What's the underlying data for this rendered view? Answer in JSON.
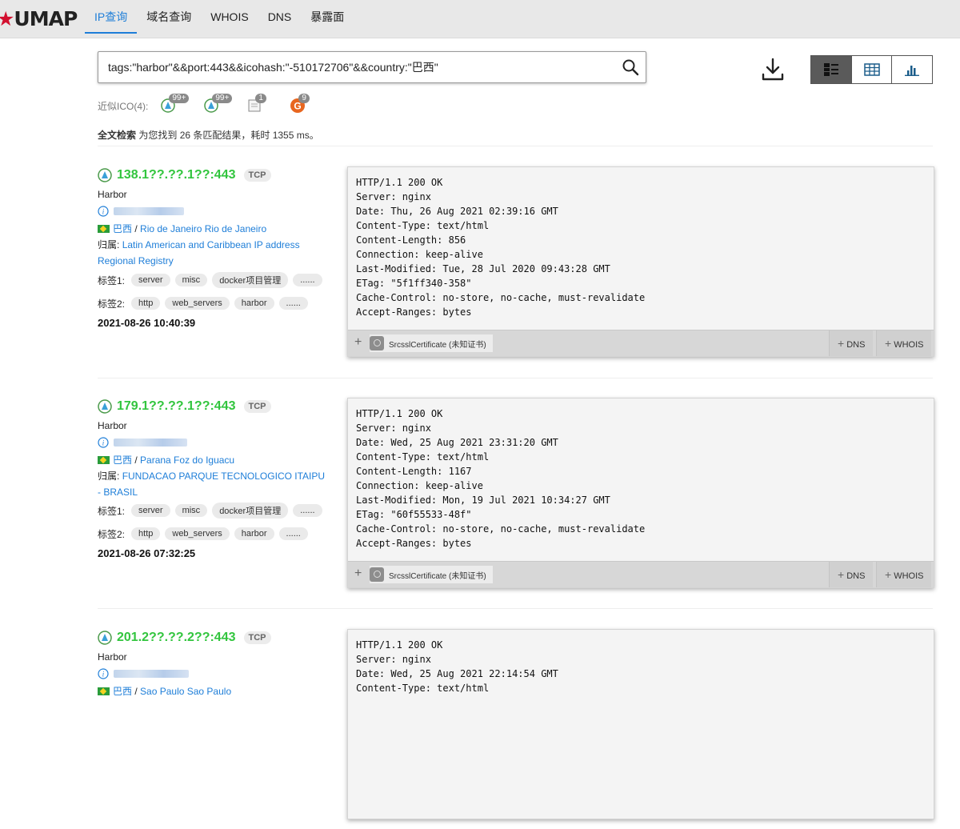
{
  "nav": {
    "logo_mark": "★",
    "logo_text": "UMAP",
    "items": [
      "IP查询",
      "域名查询",
      "WHOIS",
      "DNS",
      "暴露面"
    ]
  },
  "search": {
    "query": "tags:\"harbor\"&&port:443&&icohash:\"-510172706\"&&country:\"巴西\""
  },
  "similar": {
    "label": "近似ICO(4):",
    "items": [
      {
        "icon": "harbor-icon",
        "count": "99+"
      },
      {
        "icon": "harbor-icon",
        "count": "99+"
      },
      {
        "icon": "document-icon",
        "count": "1"
      },
      {
        "icon": "g-logo-icon",
        "count": "9"
      }
    ]
  },
  "summary": {
    "prefix": "全文检索",
    "text": "为您找到 26 条匹配结果，耗时 1355 ms。"
  },
  "results": [
    {
      "ip": "138.1??.??.1??:443",
      "protocol": "TCP",
      "app": "Harbor",
      "country": "巴西",
      "location": "Rio de Janeiro Rio de Janeiro",
      "owner_label": "归属:",
      "owner": "Latin American and Caribbean IP address Regional Registry",
      "tags1_label": "标签1:",
      "tags1": [
        "server",
        "misc",
        "docker项目管理",
        "......"
      ],
      "tags2_label": "标签2:",
      "tags2": [
        "http",
        "web_servers",
        "harbor",
        "......"
      ],
      "time": "2021-08-26 10:40:39",
      "banner": "HTTP/1.1 200 OK\nServer: nginx\nDate: Thu, 26 Aug 2021 02:39:16 GMT\nContent-Type: text/html\nContent-Length: 856\nConnection: keep-alive\nLast-Modified: Tue, 28 Jul 2020 09:43:28 GMT\nETag: \"5f1ff340-358\"\nCache-Control: no-store, no-cache, must-revalidate\nAccept-Ranges: bytes",
      "cert": "SrcsslCertificate (未知证书)",
      "dns": "DNS",
      "whois": "WHOIS"
    },
    {
      "ip": "179.1??.??.1??:443",
      "protocol": "TCP",
      "app": "Harbor",
      "country": "巴西",
      "location": "Parana Foz do Iguacu",
      "owner_label": "归属:",
      "owner": "FUNDACAO PARQUE TECNOLOGICO ITAIPU - BRASIL",
      "tags1_label": "标签1:",
      "tags1": [
        "server",
        "misc",
        "docker项目管理",
        "......"
      ],
      "tags2_label": "标签2:",
      "tags2": [
        "http",
        "web_servers",
        "harbor",
        "......"
      ],
      "time": "2021-08-26 07:32:25",
      "banner": "HTTP/1.1 200 OK\nServer: nginx\nDate: Wed, 25 Aug 2021 23:31:20 GMT\nContent-Type: text/html\nContent-Length: 1167\nConnection: keep-alive\nLast-Modified: Mon, 19 Jul 2021 10:34:27 GMT\nETag: \"60f55533-48f\"\nCache-Control: no-store, no-cache, must-revalidate\nAccept-Ranges: bytes",
      "cert": "SrcsslCertificate (未知证书)",
      "dns": "DNS",
      "whois": "WHOIS"
    },
    {
      "ip": "201.2??.??.2??:443",
      "protocol": "TCP",
      "app": "Harbor",
      "country": "巴西",
      "location": "Sao Paulo Sao Paulo",
      "banner": "HTTP/1.1 200 OK\nServer: nginx\nDate: Wed, 25 Aug 2021 22:14:54 GMT\nContent-Type: text/html"
    }
  ]
}
